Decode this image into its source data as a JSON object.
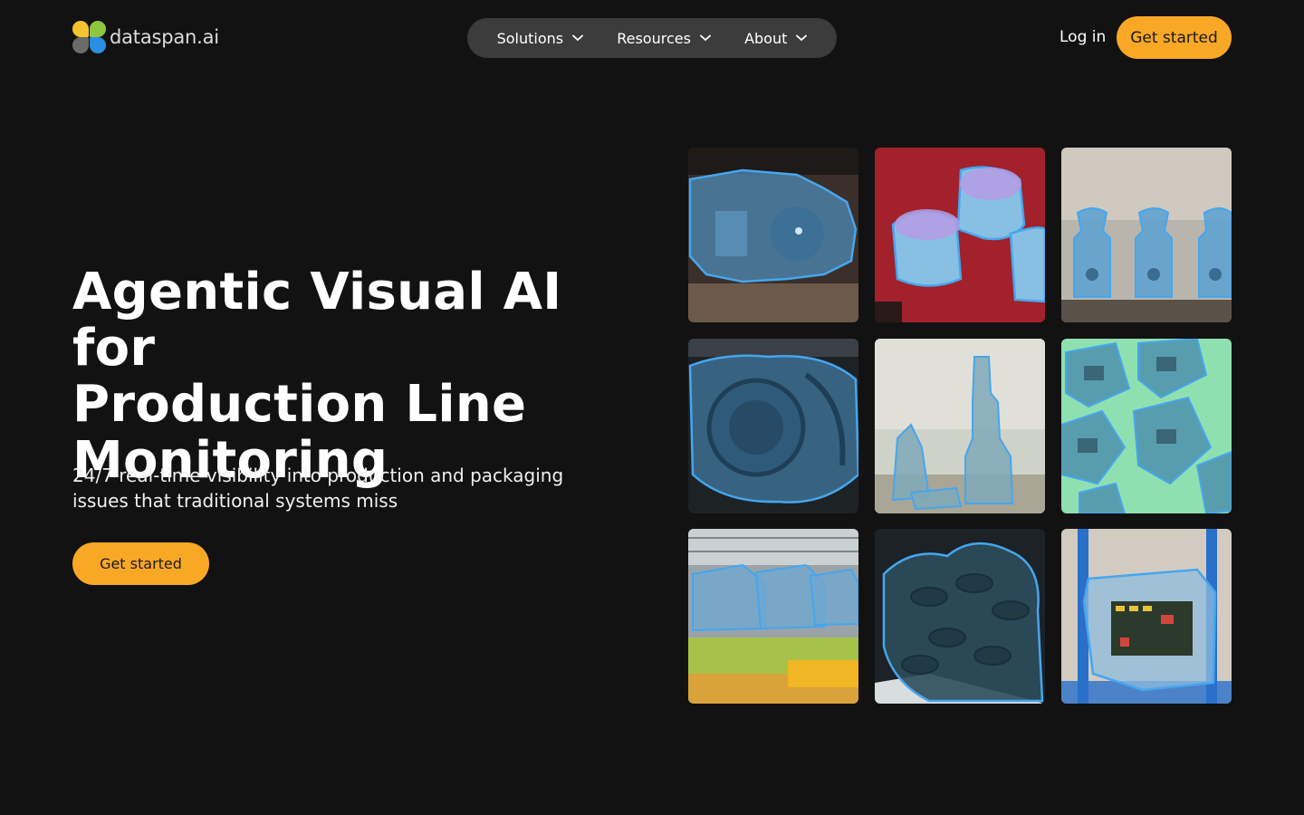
{
  "brand": {
    "name": "dataspan.ai",
    "logo_colors": [
      "#f5c330",
      "#8cc63f",
      "#6b6b6b",
      "#2a8fe0"
    ]
  },
  "nav": {
    "items": [
      {
        "label": "Solutions",
        "icon": "chevron-down-icon"
      },
      {
        "label": "Resources",
        "icon": "chevron-down-icon"
      },
      {
        "label": "About",
        "icon": "chevron-down-icon"
      }
    ],
    "login_label": "Log in",
    "cta_label": "Get started"
  },
  "hero": {
    "title_lines": [
      "Agentic Visual AI for",
      "Production Line",
      "Monitoring"
    ],
    "subtitle": "24/7 real-time visibility into production and packaging issues that traditional systems miss",
    "cta_label": "Get started"
  },
  "gallery": {
    "tiles": [
      "train-bogie-segmentation",
      "capacitors-on-circuit-board-segmentation",
      "machine-parts-on-conveyor-segmentation",
      "tire-segmentation",
      "spindle-gear-segmentation",
      "mechanical-modules-segmentation",
      "car-assembly-line-segmentation",
      "rubber-gears-segmentation",
      "electronics-board-segmentation"
    ],
    "overlay_color": "#3fa0e6"
  },
  "colors": {
    "background": "#121212",
    "accent": "#f9a826",
    "nav_pill": "#3c3c3c"
  }
}
